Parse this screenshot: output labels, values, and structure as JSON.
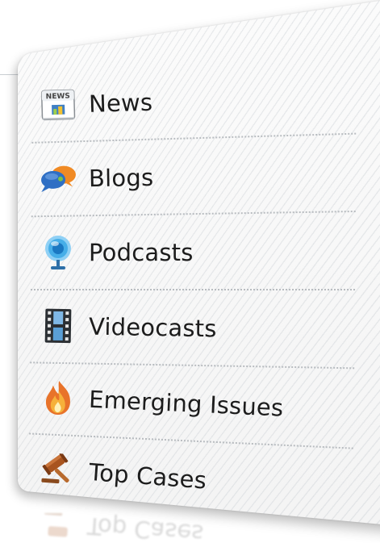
{
  "menu": {
    "items": [
      {
        "label": "News",
        "icon": "news-icon"
      },
      {
        "label": "Blogs",
        "icon": "chat-bubbles-icon"
      },
      {
        "label": "Podcasts",
        "icon": "microphone-icon"
      },
      {
        "label": "Videocasts",
        "icon": "film-strip-icon"
      },
      {
        "label": "Emerging Issues",
        "icon": "flame-icon"
      },
      {
        "label": "Top Cases",
        "icon": "gavel-icon"
      }
    ]
  },
  "colors": {
    "label_text": "#1c1c1c",
    "divider": "#b8bcc0",
    "panel_bg": "#f6f6f6"
  }
}
